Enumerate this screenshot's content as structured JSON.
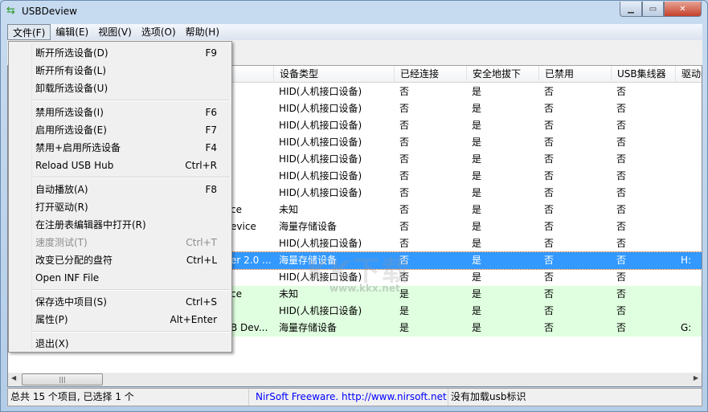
{
  "window": {
    "title": "USBDeview",
    "icon": "usb-icon"
  },
  "menubar": [
    "文件(F)",
    "编辑(E)",
    "视图(V)",
    "选项(O)",
    "帮助(H)"
  ],
  "columns": [
    "设备类型",
    "已经连接",
    "安全地拔下",
    "已禁用",
    "USB集线器",
    "驱动器"
  ],
  "rows": [
    {
      "name": "",
      "type": "HID(人机接口设备)",
      "connected": "否",
      "safe": "是",
      "disabled": "否",
      "hub": "否",
      "drive": "",
      "style": "normal"
    },
    {
      "name": "",
      "type": "HID(人机接口设备)",
      "connected": "否",
      "safe": "是",
      "disabled": "否",
      "hub": "否",
      "drive": "",
      "style": "normal"
    },
    {
      "name": "",
      "type": "HID(人机接口设备)",
      "connected": "否",
      "safe": "是",
      "disabled": "否",
      "hub": "否",
      "drive": "",
      "style": "normal"
    },
    {
      "name": "",
      "type": "HID(人机接口设备)",
      "connected": "否",
      "safe": "是",
      "disabled": "否",
      "hub": "否",
      "drive": "",
      "style": "normal"
    },
    {
      "name": "",
      "type": "HID(人机接口设备)",
      "connected": "否",
      "safe": "是",
      "disabled": "否",
      "hub": "否",
      "drive": "",
      "style": "normal"
    },
    {
      "name": "",
      "type": "HID(人机接口设备)",
      "connected": "否",
      "safe": "是",
      "disabled": "否",
      "hub": "否",
      "drive": "",
      "style": "normal"
    },
    {
      "name": "",
      "type": "HID(人机接口设备)",
      "connected": "否",
      "safe": "是",
      "disabled": "否",
      "hub": "否",
      "drive": "",
      "style": "normal"
    },
    {
      "name": "ce",
      "type": "未知",
      "connected": "否",
      "safe": "是",
      "disabled": "否",
      "hub": "否",
      "drive": "",
      "style": "normal"
    },
    {
      "name": "evice",
      "type": "海量存储设备",
      "connected": "否",
      "safe": "是",
      "disabled": "否",
      "hub": "否",
      "drive": "",
      "style": "normal"
    },
    {
      "name": "",
      "type": "HID(人机接口设备)",
      "connected": "否",
      "safe": "是",
      "disabled": "否",
      "hub": "否",
      "drive": "",
      "style": "normal"
    },
    {
      "name": "er 2.0 ...",
      "type": "海量存储设备",
      "connected": "否",
      "safe": "是",
      "disabled": "否",
      "hub": "否",
      "drive": "H:",
      "style": "sel"
    },
    {
      "name": "",
      "type": "HID(人机接口设备)",
      "connected": "否",
      "safe": "是",
      "disabled": "否",
      "hub": "否",
      "drive": "",
      "style": "normal"
    },
    {
      "name": "ce",
      "type": "未知",
      "connected": "是",
      "safe": "是",
      "disabled": "否",
      "hub": "否",
      "drive": "",
      "style": "green"
    },
    {
      "name": "",
      "type": "HID(人机接口设备)",
      "connected": "是",
      "safe": "是",
      "disabled": "否",
      "hub": "否",
      "drive": "",
      "style": "green"
    },
    {
      "name": "B Dev...",
      "type": "海量存储设备",
      "connected": "是",
      "safe": "是",
      "disabled": "否",
      "hub": "否",
      "drive": "G:",
      "style": "green"
    }
  ],
  "file_menu": [
    {
      "label": "断开所选设备(D)",
      "shortcut": "F9"
    },
    {
      "label": "断开所有设备(L)",
      "shortcut": ""
    },
    {
      "label": "卸载所选设备(U)",
      "shortcut": ""
    },
    {
      "sep": true
    },
    {
      "label": "禁用所选设备(I)",
      "shortcut": "F6"
    },
    {
      "label": "启用所选设备(E)",
      "shortcut": "F7"
    },
    {
      "label": "禁用+启用所选设备",
      "shortcut": "F4"
    },
    {
      "label": "Reload USB Hub",
      "shortcut": "Ctrl+R"
    },
    {
      "sep": true
    },
    {
      "label": "自动播放(A)",
      "shortcut": "F8"
    },
    {
      "label": "打开驱动(R)",
      "shortcut": ""
    },
    {
      "label": "在注册表编辑器中打开(R)",
      "shortcut": ""
    },
    {
      "label": "速度测试(T)",
      "shortcut": "Ctrl+T",
      "disabled": true
    },
    {
      "label": "改变已分配的盘符",
      "shortcut": "Ctrl+L"
    },
    {
      "label": "Open INF File",
      "shortcut": ""
    },
    {
      "sep": true
    },
    {
      "label": "保存选中项目(S)",
      "shortcut": "Ctrl+S"
    },
    {
      "label": "属性(P)",
      "shortcut": "Alt+Enter"
    },
    {
      "sep": true
    },
    {
      "label": "退出(X)",
      "shortcut": ""
    }
  ],
  "status": {
    "count": "总共 15 个项目, 已选择 1 个",
    "link": "NirSoft Freeware.  http://www.nirsoft.net",
    "usbids": "没有加载usb标识"
  },
  "watermark": {
    "logo": "KK下载",
    "url": "www.kkx.net"
  },
  "colors": {
    "selected": "#3399ff",
    "connected_row": "#e0ffe0",
    "link": "#0000ff"
  }
}
